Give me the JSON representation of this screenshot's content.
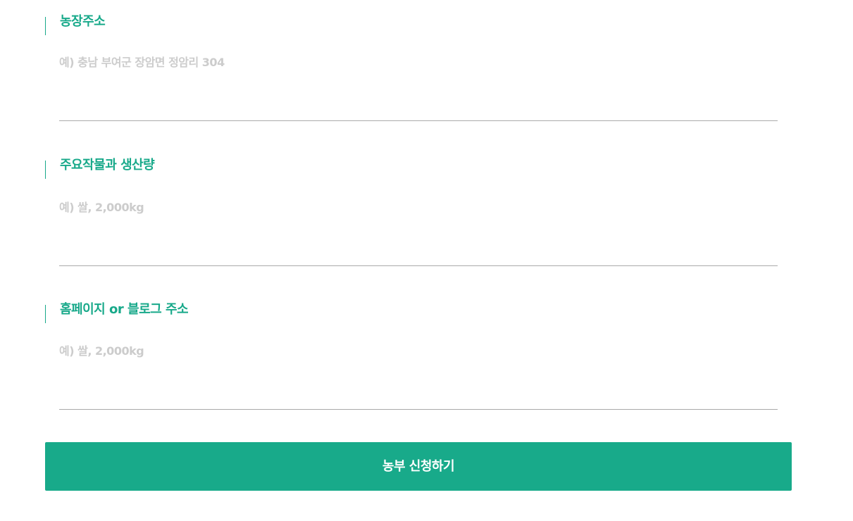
{
  "form": {
    "fields": [
      {
        "label": "농장주소",
        "placeholder": "예) 충남 부여군 장암면 정암리 304",
        "value": ""
      },
      {
        "label": "주요작물과 생산량",
        "placeholder": "예) 쌀, 2,000kg",
        "value": ""
      },
      {
        "label": "홈페이지 or 블로그 주소",
        "placeholder": "예) 쌀, 2,000kg",
        "value": ""
      }
    ],
    "submit_label": "농부 신청하기"
  },
  "colors": {
    "accent": "#18A98A",
    "placeholder": "#CCCCCC",
    "divider": "#AAAAAA",
    "button_text": "#FFFFFF"
  }
}
